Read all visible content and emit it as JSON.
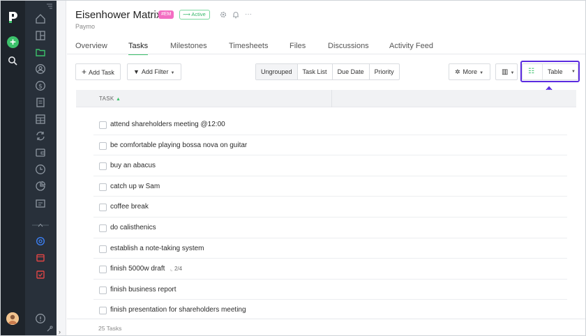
{
  "colors": {
    "accent_green": "#3cc26b",
    "tag_pink": "#f36ec2",
    "highlight_purple": "#5b2be0",
    "rail_dark": "#1e242b"
  },
  "project": {
    "title": "Eisenhower Matrix",
    "tag": "#EM",
    "status": "Active",
    "subtitle": "Paymo"
  },
  "tabs": [
    {
      "label": "Overview",
      "active": false
    },
    {
      "label": "Tasks",
      "active": true
    },
    {
      "label": "Milestones",
      "active": false
    },
    {
      "label": "Timesheets",
      "active": false
    },
    {
      "label": "Files",
      "active": false
    },
    {
      "label": "Discussions",
      "active": false
    },
    {
      "label": "Activity Feed",
      "active": false
    }
  ],
  "toolbar": {
    "add_task": "Add Task",
    "add_filter": "Add Filter",
    "grouping": [
      "Ungrouped",
      "Task List",
      "Due Date",
      "Priority"
    ],
    "grouping_selected": "Ungrouped",
    "more": "More",
    "view": "Table"
  },
  "table": {
    "column_task": "TASK",
    "rows": [
      {
        "name": "attend shareholders meeting @12:00"
      },
      {
        "name": "be comfortable playing bossa nova on guitar"
      },
      {
        "name": "buy an abacus"
      },
      {
        "name": "catch up w Sam"
      },
      {
        "name": "coffee break"
      },
      {
        "name": "do calisthenics"
      },
      {
        "name": "establish a note-taking system"
      },
      {
        "name": "finish 5000w draft",
        "subtasks": "2/4"
      },
      {
        "name": "finish business report"
      },
      {
        "name": "finish presentation for shareholders meeting"
      }
    ]
  },
  "footer": {
    "count": "25 Tasks"
  },
  "icons": {
    "rail": [
      "paymo-logo-icon",
      "add-icon",
      "search-icon",
      "user-avatar"
    ],
    "nav": [
      "home-icon",
      "building-icon",
      "folder-icon",
      "user-circle-icon",
      "dollar-icon",
      "invoice-icon",
      "grid-icon",
      "sync-icon",
      "wallet-icon",
      "clock-icon",
      "pie-chart-icon",
      "list-icon",
      "at-icon",
      "calendar-icon",
      "check-square-icon",
      "info-icon"
    ]
  }
}
